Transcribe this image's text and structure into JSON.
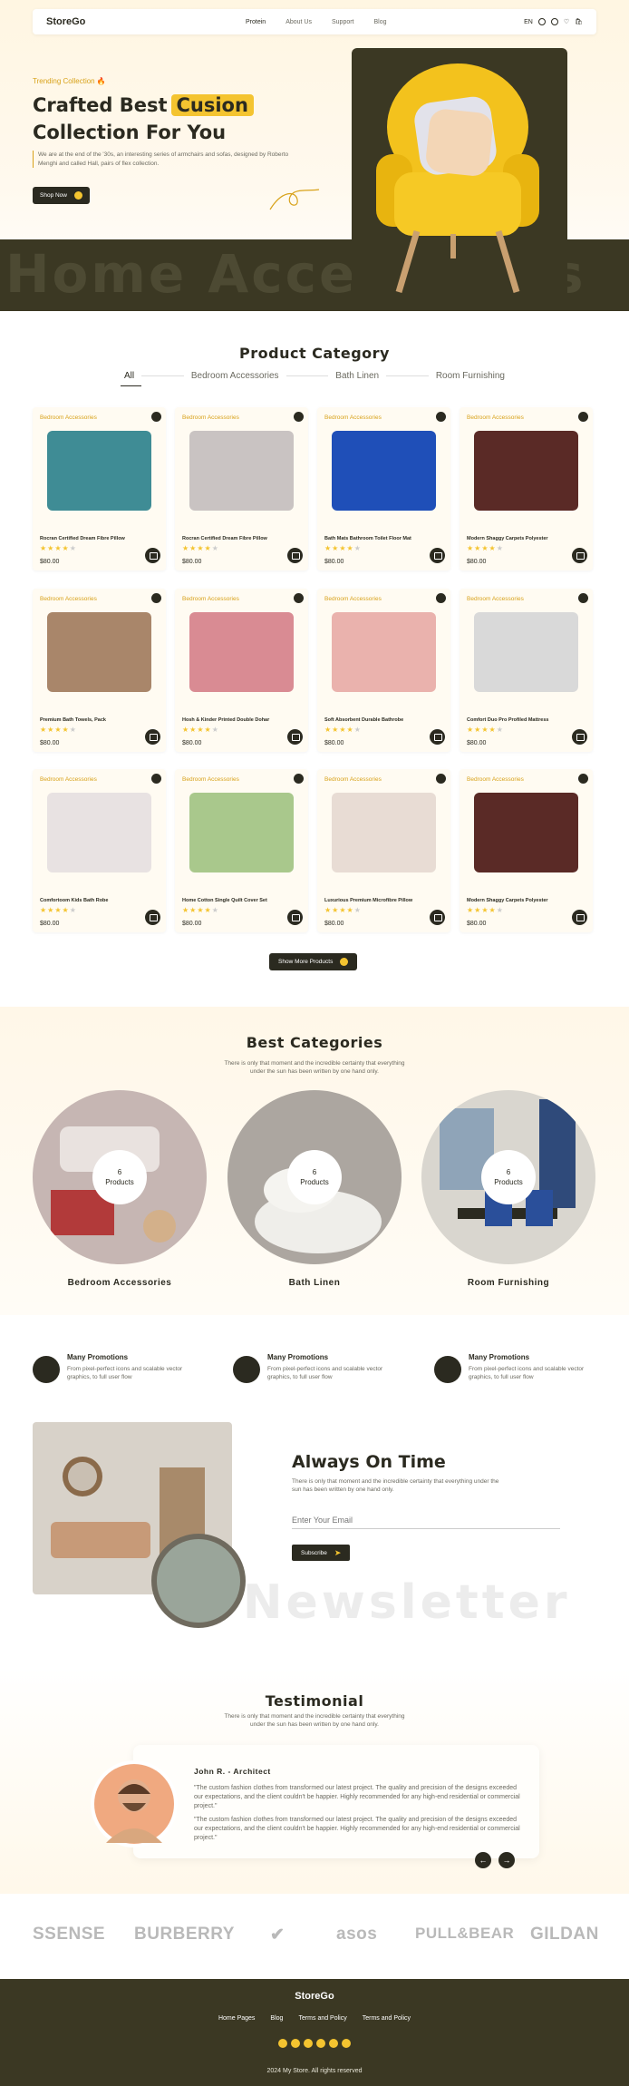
{
  "header": {
    "logo": "StoreGo",
    "nav": [
      "Protein",
      "About Us",
      "Support",
      "Blog"
    ],
    "lang": "EN"
  },
  "hero": {
    "trending": "Trending Collection 🔥",
    "title_line1": "Crafted Best",
    "title_highlight": "Cusion",
    "title_line2": "Collection For You",
    "desc": "We are at the end of the '30s, an interesting series of armchairs and sofas, designed by Roberto Menghi and called Hall, pairs of flex collection.",
    "cta": "Shop Now",
    "bg_text": "Home Accessories"
  },
  "category": {
    "title": "Product Category",
    "tabs": [
      "All",
      "Bedroom Accessories",
      "Bath Linen",
      "Room Furnishing"
    ],
    "products": [
      {
        "cat": "Bedroom Accessories",
        "name": "Rocran Certified Dream Fibre Pillow",
        "price": "$80.00",
        "rating": 4,
        "color": "#3f8c95"
      },
      {
        "cat": "Bedroom Accessories",
        "name": "Rocran Certified Dream Fibre Pillow",
        "price": "$80.00",
        "rating": 4,
        "color": "#c9c3c2"
      },
      {
        "cat": "Bedroom Accessories",
        "name": "Bath Mats Bathroom Toilet Floor Mat",
        "price": "$80.00",
        "rating": 4,
        "color": "#1f4fb8"
      },
      {
        "cat": "Bedroom Accessories",
        "name": "Modern Shaggy Carpets Polyester",
        "price": "$80.00",
        "rating": 4,
        "color": "#5a2a26"
      },
      {
        "cat": "Bedroom Accessories",
        "name": "Premium Bath Towels, Pack",
        "price": "$80.00",
        "rating": 4,
        "color": "#a9866a"
      },
      {
        "cat": "Bedroom Accessories",
        "name": "Hosh & Kinder Printed Double Dohar",
        "price": "$80.00",
        "rating": 4,
        "color": "#d98b93"
      },
      {
        "cat": "Bedroom Accessories",
        "name": "Soft Absorbent Durable Bathrobe",
        "price": "$80.00",
        "rating": 4,
        "color": "#eab2ad"
      },
      {
        "cat": "Bedroom Accessories",
        "name": "Comfort Duo Pro Profiled Mattress",
        "price": "$80.00",
        "rating": 4,
        "color": "#d9d9d9"
      },
      {
        "cat": "Bedroom Accessories",
        "name": "Comfortoom Kids Bath Robe",
        "price": "$80.00",
        "rating": 4,
        "color": "#e8e2e2"
      },
      {
        "cat": "Bedroom Accessories",
        "name": "Home Cotton Single Quilt Cover Set",
        "price": "$80.00",
        "rating": 4,
        "color": "#a9c88c"
      },
      {
        "cat": "Bedroom Accessories",
        "name": "Luxurious Premium Microfibre Pillow",
        "price": "$80.00",
        "rating": 4,
        "color": "#e8dcd4"
      },
      {
        "cat": "Bedroom Accessories",
        "name": "Modern Shaggy Carpets Polyester",
        "price": "$80.00",
        "rating": 4,
        "color": "#5a2a26"
      }
    ],
    "more": "Show More Products"
  },
  "best": {
    "title": "Best Categories",
    "desc_line1": "There is only that moment and the incredible certainty that everything",
    "desc_line2": "under the sun has been written by one hand only.",
    "items": [
      {
        "count": "6",
        "unit": "Products",
        "label": "Bedroom Accessories",
        "color": "#b9a8a6"
      },
      {
        "count": "6",
        "unit": "Products",
        "label": "Bath Linen",
        "color": "#a7a29e"
      },
      {
        "count": "6",
        "unit": "Products",
        "label": "Room Furnishing",
        "color": "#7d8da0"
      }
    ]
  },
  "promos": [
    {
      "title": "Many Promotions",
      "desc": "From pixel-perfect icons and scalable vector graphics, to full user flow"
    },
    {
      "title": "Many Promotions",
      "desc": "From pixel-perfect icons and scalable vector graphics, to full user flow"
    },
    {
      "title": "Many Promotions",
      "desc": "From pixel-perfect icons and scalable vector graphics, to full user flow"
    }
  ],
  "newsletter": {
    "title": "Always On Time",
    "desc": "There is only that moment and the incredible certainty that everything under the sun has been written by one hand only.",
    "placeholder": "Enter Your Email",
    "button": "Subscribe",
    "bg_text": "Newsletter"
  },
  "testimonial": {
    "title": "Testimonial",
    "desc_line1": "There is only that moment and the incredible certainty that everything",
    "desc_line2": "under the sun has been written by one hand only.",
    "name": "John R. - Architect",
    "q1": "\"The custom fashion clothes from transformed our latest project. The quality and precision of the designs exceeded our expectations, and the client couldn't be happier. Highly recommended for any high-end residential or commercial project.\"",
    "q2": "\"The custom fashion clothes from transformed our latest project. The quality and precision of the designs exceeded our expectations, and the client couldn't be happier. Highly recommended for any high-end residential or commercial project.\"",
    "prev": "←",
    "next": "→"
  },
  "brands": [
    "SSENSE",
    "BURBERRY",
    "✔",
    "asos",
    "PULL&BEAR",
    "GILDAN"
  ],
  "footer": {
    "logo": "StoreGo",
    "links": [
      "Home Pages",
      "Blog",
      "Terms and Policy",
      "Terms and Policy"
    ],
    "copy": "2024 My Store. All rights reserved"
  },
  "colors": {
    "dark": "#3b3823",
    "accent": "#f4c430",
    "bg": "#fff7e8"
  }
}
